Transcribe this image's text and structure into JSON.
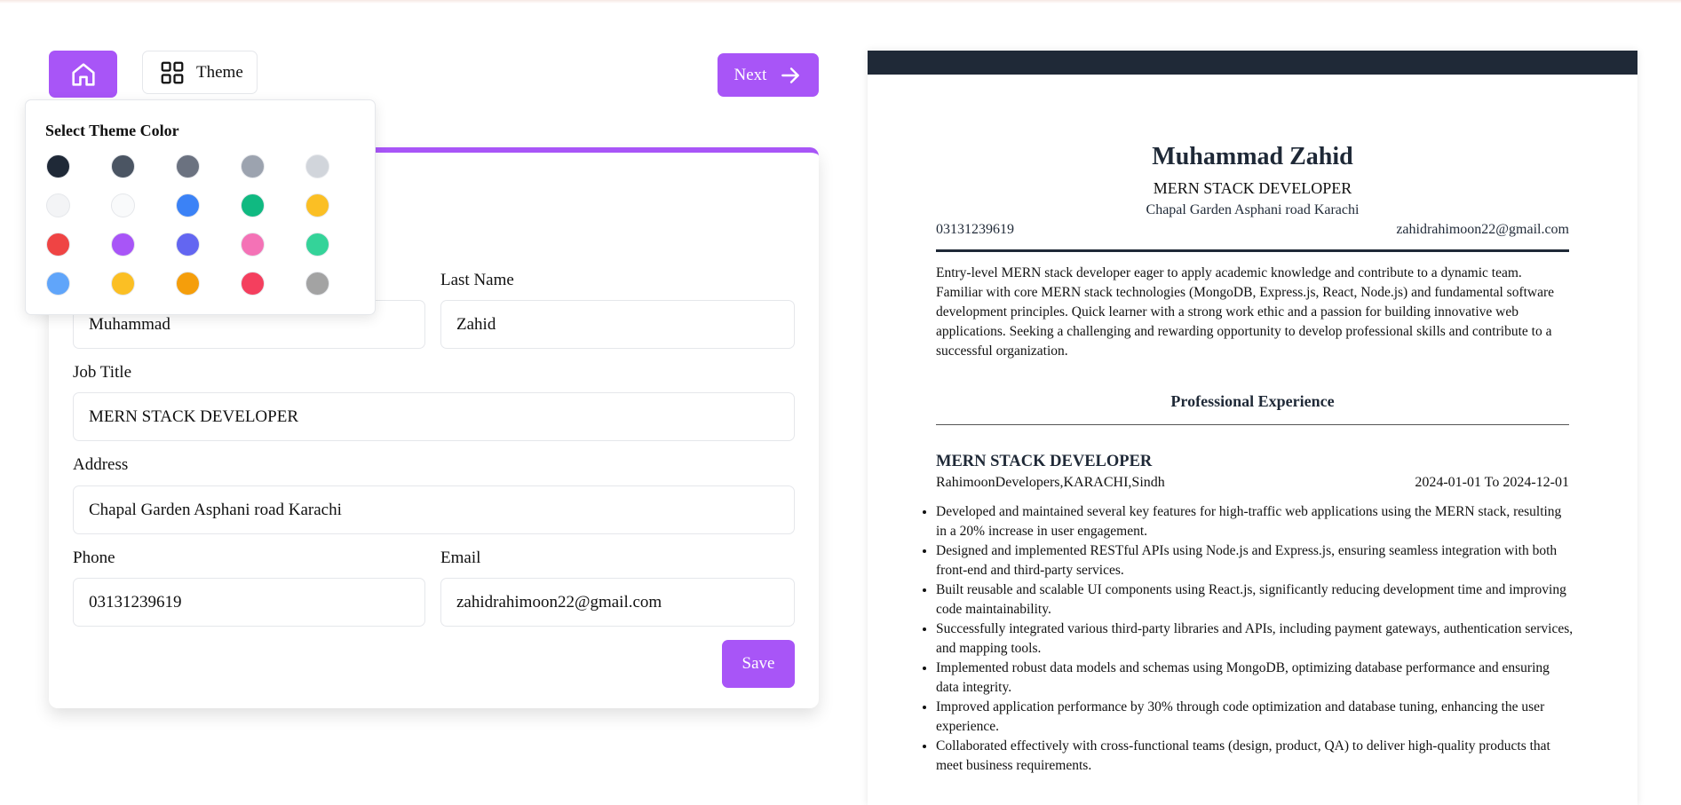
{
  "toolbar": {
    "theme_label": "Theme",
    "next_label": "Next"
  },
  "theme_picker": {
    "title": "Select Theme Color",
    "colors": [
      "#1f2937",
      "#4b5563",
      "#6b7280",
      "#9ca3af",
      "#d1d5db",
      "#f3f4f6",
      "#f9fafb",
      "#3b82f6",
      "#10b981",
      "#fbbf24",
      "#ef4444",
      "#a855f7",
      "#6366f1",
      "#f472b6",
      "#34d399",
      "#60a5fa",
      "#fbbf24",
      "#f59e0b",
      "#f43f5e",
      "#a3a3a3"
    ]
  },
  "form": {
    "last_name_label": "Last Name",
    "first_name_value": "Muhammad",
    "last_name_value": "Zahid",
    "job_title_label": "Job Title",
    "job_title_value": "MERN STACK DEVELOPER",
    "address_label": "Address",
    "address_value": "Chapal Garden Asphani road Karachi",
    "phone_label": "Phone",
    "phone_value": "03131239619",
    "email_label": "Email",
    "email_value": "zahidrahimoon22@gmail.com",
    "save_label": "Save"
  },
  "resume": {
    "name": "Muhammad Zahid",
    "job_title": "MERN STACK DEVELOPER",
    "address": "Chapal Garden Asphani road Karachi",
    "phone": "03131239619",
    "email": "zahidrahimoon22@gmail.com",
    "summary": "Entry-level MERN stack developer eager to apply academic knowledge and contribute to a dynamic team. Familiar with core MERN stack technologies (MongoDB, Express.js, React, Node.js) and fundamental software development principles. Quick learner with a strong work ethic and a passion for building innovative web applications. Seeking a challenging and rewarding opportunity to develop professional skills and contribute to a successful organization.",
    "experience_heading": "Professional Experience",
    "experience": {
      "title": "MERN STACK DEVELOPER",
      "company": "RahimoonDevelopers,KARACHI,Sindh",
      "dates": "2024-01-01 To 2024-12-01",
      "bullets": [
        " Developed and maintained several key features for high-traffic web applications using the MERN stack, resulting in a 20% increase in user engagement.",
        "Designed and implemented RESTful APIs using Node.js and Express.js, ensuring seamless integration with both front-end and third-party services.",
        "Built reusable and scalable UI components using React.js, significantly reducing development time and improving code maintainability.",
        "Successfully integrated various third-party libraries and APIs, including payment gateways, authentication services, and mapping tools.",
        "Implemented robust data models and schemas using MongoDB, optimizing database performance and ensuring data integrity.",
        "Improved application performance by 30% through code optimization and database tuning, enhancing the user experience.",
        "Collaborated effectively with cross-functional teams (design, product, QA) to deliver high-quality products that meet business requirements."
      ]
    }
  }
}
